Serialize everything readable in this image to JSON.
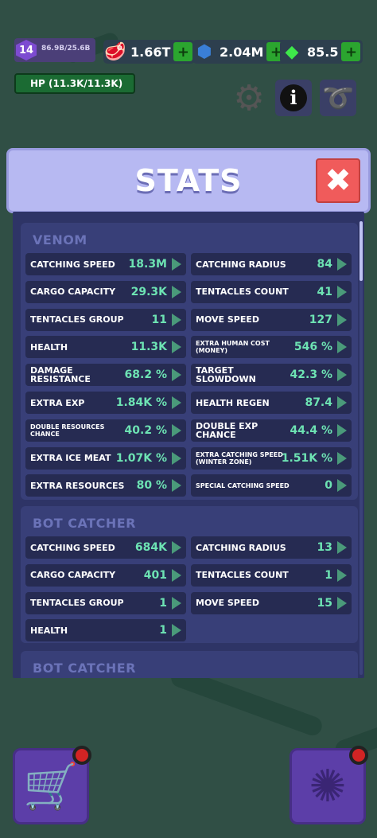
{
  "hud": {
    "level": "14",
    "xp": "86.9B/25.6B",
    "meat": "1.66T",
    "ore": "2.04M",
    "gems": "85.5",
    "hp": "HP (11.3K/11.3K)",
    "meat_icon": "meat-icon",
    "ore_icon": "blue-ore-icon",
    "gem_icon": "gem-icon"
  },
  "panel": {
    "title": "STATS",
    "close_icon": "close-icon"
  },
  "sections": [
    {
      "title": "VENOM",
      "rows": [
        [
          "CATCHING SPEED",
          "18.3M",
          "CATCHING RADIUS",
          "84"
        ],
        [
          "CARGO CAPACITY",
          "29.3K",
          "TENTACLES COUNT",
          "41"
        ],
        [
          "TENTACLES GROUP",
          "11",
          "MOVE SPEED",
          "127"
        ],
        [
          "HEALTH",
          "11.3K",
          "EXTRA HUMAN COST (MONEY)",
          "546 %"
        ],
        [
          "DAMAGE RESISTANCE",
          "68.2 %",
          "TARGET SLOWDOWN",
          "42.3 %"
        ],
        [
          "EXTRA EXP",
          "1.84K %",
          "HEALTH REGEN",
          "87.4"
        ],
        [
          "DOUBLE RESOURCES CHANCE",
          "40.2 %",
          "DOUBLE EXP CHANCE",
          "44.4 %"
        ],
        [
          "EXTRA ICE MEAT",
          "1.07K %",
          "EXTRA CATCHING SPEED (WINTER ZONE)",
          "1.51K %"
        ],
        [
          "EXTRA RESOURCES",
          "80 %",
          "SPECIAL CATCHING SPEED",
          "0"
        ]
      ]
    },
    {
      "title": "BOT CATCHER",
      "rows": [
        [
          "CATCHING SPEED",
          "684K",
          "CATCHING RADIUS",
          "13"
        ],
        [
          "CARGO CAPACITY",
          "401",
          "TENTACLES COUNT",
          "1"
        ],
        [
          "TENTACLES GROUP",
          "1",
          "MOVE SPEED",
          "15"
        ],
        [
          "HEALTH",
          "1",
          "",
          ""
        ]
      ]
    },
    {
      "title": "BOT CATCHER",
      "rows": []
    }
  ]
}
